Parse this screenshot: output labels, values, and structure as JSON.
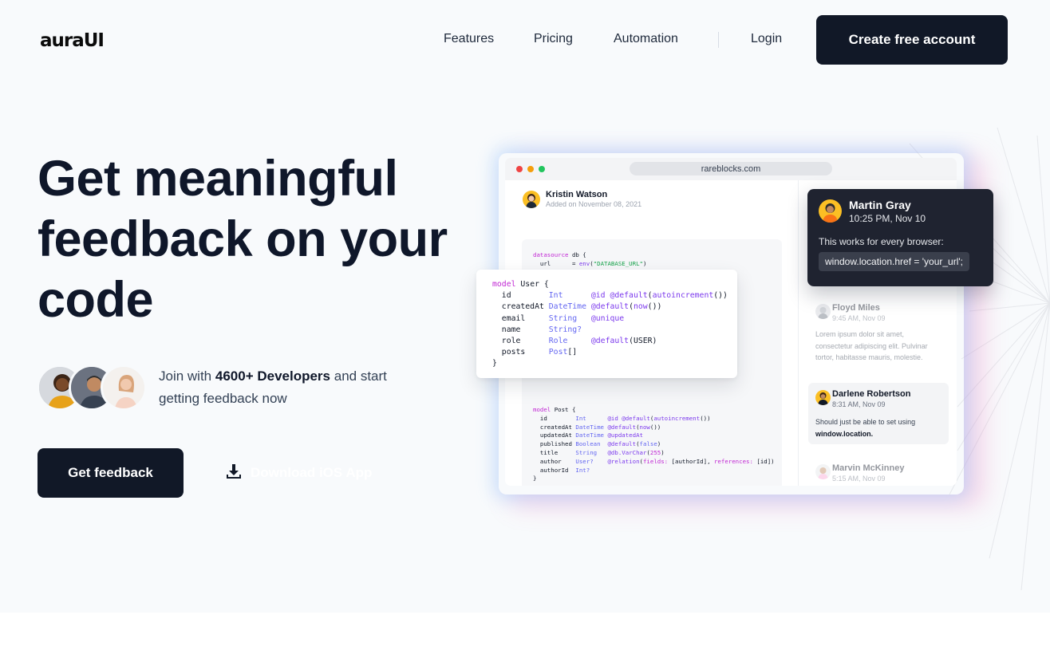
{
  "brand": {
    "logo": "auraUI"
  },
  "nav": {
    "links": [
      "Features",
      "Pricing",
      "Automation",
      "Login"
    ],
    "cta": "Create free account"
  },
  "hero": {
    "headline": "Get meaningful feedback on your code",
    "join_prefix": "Join with ",
    "join_bold": "4600+ Developers",
    "join_suffix": " and start getting feedback now",
    "primary_button": "Get feedback",
    "secondary_button": "Download iOS App"
  },
  "mockup": {
    "url": "rareblocks.com",
    "post_author": "Kristin Watson",
    "post_date": "Added on November 08, 2021",
    "comments": [
      {
        "name": "Martin Gray",
        "time": "10:25 PM, Nov 10",
        "text": "This works for every browser:",
        "code": "window.location.href = 'your_url';"
      },
      {
        "name": "Floyd Miles",
        "time": "9:45 AM, Nov 09",
        "text": "Lorem ipsum dolor sit amet, consectetur adipiscing elit. Pulvinar tortor, habitasse mauris, molestie."
      },
      {
        "name": "Darlene Robertson",
        "time": "8:31 AM, Nov 09",
        "text": "Should just be able to set using",
        "code": "window.location."
      },
      {
        "name": "Marvin McKinney",
        "time": "5:15 AM, Nov 09"
      }
    ]
  },
  "colors": {
    "dark": "#111827",
    "background": "#f8fafc"
  },
  "icons": [
    "download-icon"
  ]
}
